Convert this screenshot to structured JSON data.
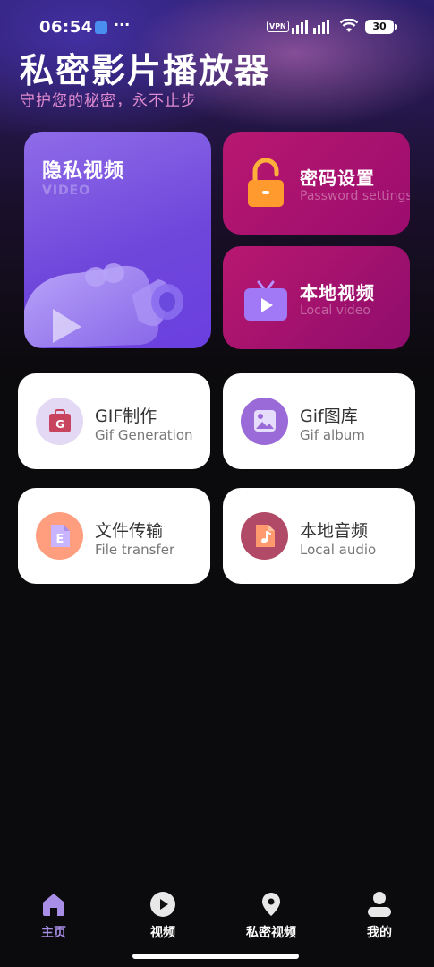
{
  "status_bar": {
    "time": "06:54",
    "more": "···",
    "vpn": "VPN",
    "battery": "30"
  },
  "header": {
    "title": "私密影片播放器",
    "subtitle": "守护您的秘密，永不止步"
  },
  "cards": {
    "private_video": {
      "title": "隐私视频",
      "subtitle": "VIDEO",
      "icon": "video-camera-icon"
    },
    "password": {
      "title": "密码设置",
      "subtitle": "Password settings",
      "icon": "lock-icon"
    },
    "local_video": {
      "title": "本地视频",
      "subtitle": "Local video",
      "icon": "tv-icon"
    }
  },
  "tools": [
    {
      "title": "GIF制作",
      "subtitle": "Gif Generation",
      "icon": "gif-maker-icon",
      "color": "#e3d9f5"
    },
    {
      "title": "Gif图库",
      "subtitle": "Gif album",
      "icon": "image-gallery-icon",
      "color": "#9a6ad8"
    },
    {
      "title": "文件传输",
      "subtitle": "File transfer",
      "icon": "file-icon",
      "color": "#ff9e7e"
    },
    {
      "title": "本地音频",
      "subtitle": "Local audio",
      "icon": "music-file-icon",
      "color": "#b04a66"
    }
  ],
  "nav": {
    "items": [
      {
        "label": "主页",
        "icon": "home-icon",
        "active": true
      },
      {
        "label": "视频",
        "icon": "play-icon",
        "active": false
      },
      {
        "label": "私密视频",
        "icon": "location-pin-icon",
        "active": false
      },
      {
        "label": "我的",
        "icon": "user-icon",
        "active": false
      }
    ]
  },
  "colors": {
    "accent": "#a98ee8",
    "video_card": "#6f47db",
    "magenta_card": "#a8106e",
    "subtitle": "#e08bd0"
  }
}
